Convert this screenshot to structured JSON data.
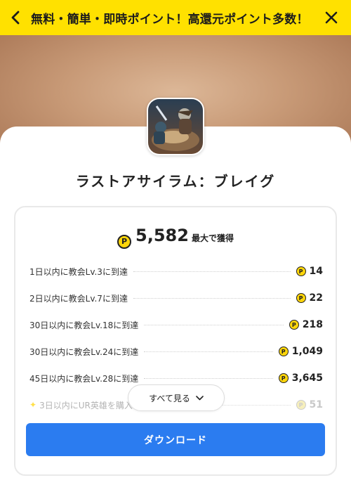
{
  "header": {
    "title": "無料・簡単・即時ポイント！高還元ポイント多数！"
  },
  "app": {
    "name": "ラストアサイラム：ブレイグ"
  },
  "reward": {
    "total": "5,582",
    "total_suffix": "最大で獲得",
    "coin_symbol": "P",
    "tasks": [
      {
        "label": "1日以内に教会Lv.3に到達",
        "points": "14"
      },
      {
        "label": "2日以内に教会Lv.7に到達",
        "points": "22"
      },
      {
        "label": "30日以内に教会Lv.18に到達",
        "points": "218"
      },
      {
        "label": "30日以内に教会Lv.24に到達",
        "points": "1,049"
      },
      {
        "label": "45日以内に教会Lv.28に到達",
        "points": "3,645"
      },
      {
        "label": "3日以内にUR英雄を購入",
        "points": "51"
      }
    ]
  },
  "actions": {
    "see_all": "すべて見る",
    "download": "ダウンロード"
  },
  "colors": {
    "banner": "#ffe100",
    "primary": "#2b7cf0",
    "coin": "#ffd60a"
  }
}
